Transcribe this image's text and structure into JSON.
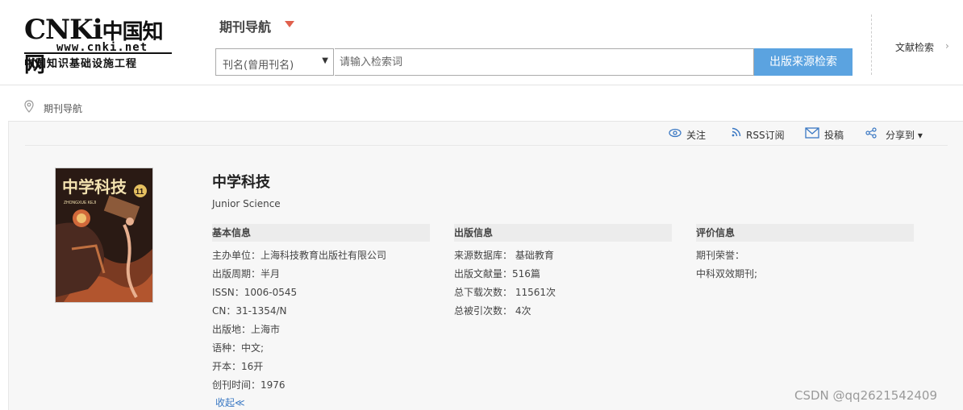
{
  "header": {
    "logo": {
      "main": "CNKi",
      "main_cn": "中国知网",
      "url": "www.cnki.net",
      "subtitle": "中国知识基础设施工程"
    },
    "nav_title": "期刊导航",
    "search": {
      "field_select": "刊名(曾用刊名)",
      "placeholder": "请输入检索词",
      "button_label": "出版来源检索"
    },
    "doc_search_label": "文献检索",
    "accent_color": "#5ba3e0",
    "arrow_color": "#e0604d"
  },
  "breadcrumb": {
    "label": "期刊导航"
  },
  "toolbar": {
    "follow_label": "关注",
    "rss_label": "RSS订阅",
    "submit_label": "投稿",
    "share_label": "分享到 ▾"
  },
  "journal": {
    "title_cn": "中学科技",
    "title_en": "Junior Science",
    "cover_text": "中学科技",
    "cover_issue": "11",
    "cover_pinyin": "ZHONGXUE KEJI"
  },
  "basic_info": {
    "header": "基本信息",
    "rows": [
      "主办单位：上海科技教育出版社有限公司",
      "出版周期：半月",
      "ISSN：1006-0545",
      "CN：31-1354/N",
      "出版地：上海市",
      "语种：中文;",
      "开本：16开",
      "创刊时间：1976"
    ]
  },
  "publish_info": {
    "header": "出版信息",
    "rows": [
      "来源数据库： 基础教育",
      "出版文献量：516篇",
      "总下载次数： 11561次",
      "总被引次数： 4次"
    ]
  },
  "eval_info": {
    "header": "评价信息",
    "rows": [
      "期刊荣誉：",
      "中科双效期刊;"
    ]
  },
  "collapse_label": "收起≪",
  "watermark": "CSDN @qq2621542409"
}
